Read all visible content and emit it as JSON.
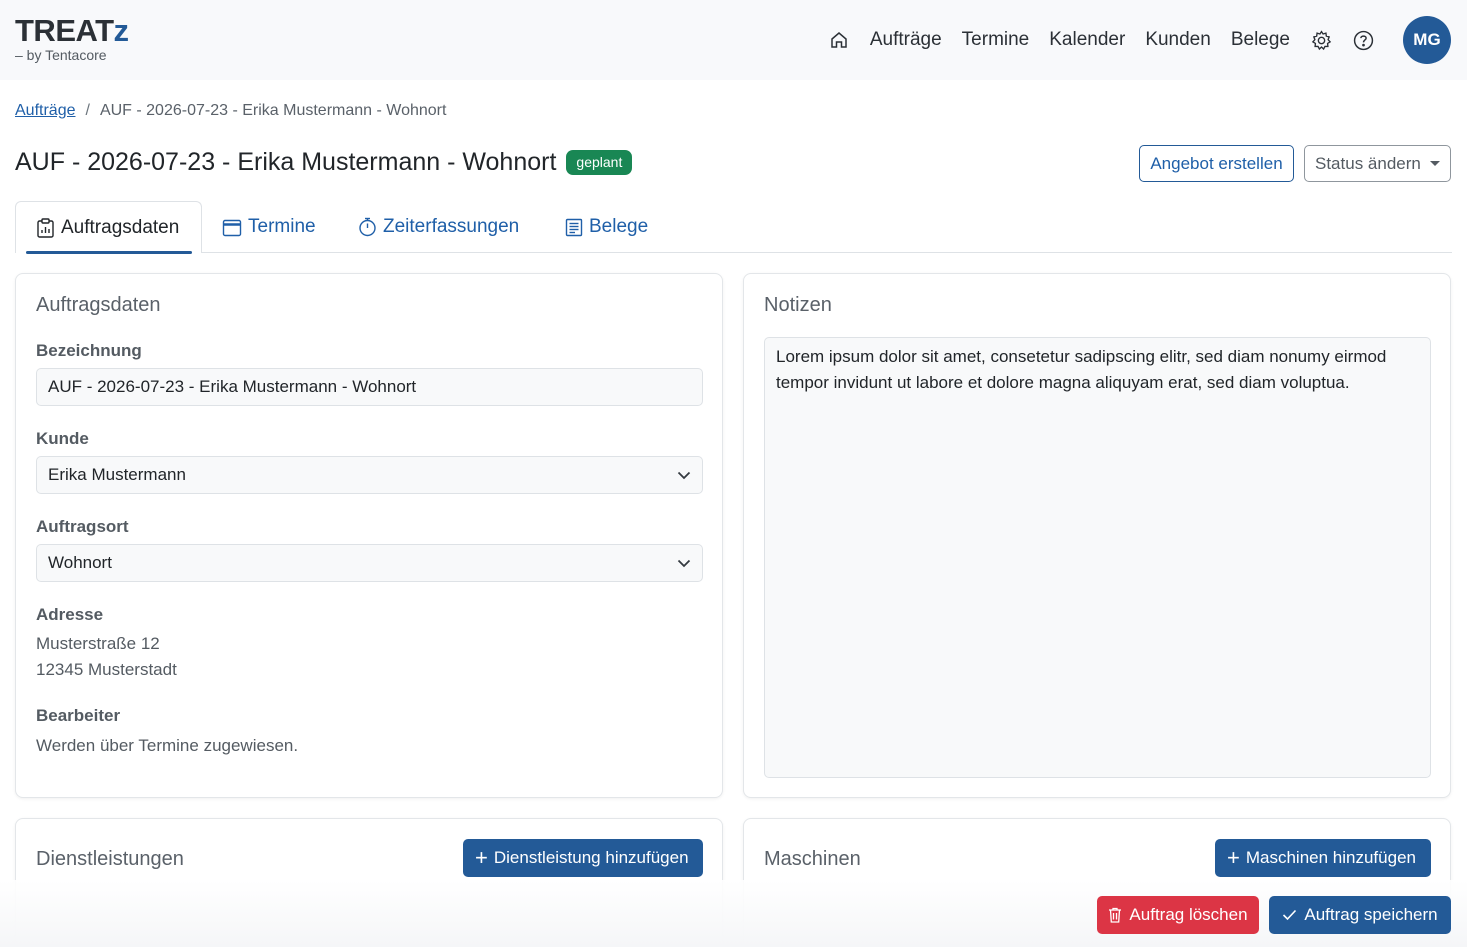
{
  "brand": {
    "name": "TREATz",
    "name_main": "TREAT",
    "name_accent": "z",
    "tagline": "– by Tentacore"
  },
  "nav": {
    "items": [
      {
        "label": "Aufträge"
      },
      {
        "label": "Termine"
      },
      {
        "label": "Kalender"
      },
      {
        "label": "Kunden"
      },
      {
        "label": "Belege"
      }
    ],
    "avatar_initials": "MG"
  },
  "breadcrumb": {
    "parent": "Aufträge",
    "separator": "/",
    "current": "AUF - 2026-07-23 - Erika Mustermann - Wohnort"
  },
  "header": {
    "title": "AUF - 2026-07-23 - Erika Mustermann - Wohnort",
    "status_badge": "geplant",
    "create_offer_label": "Angebot erstellen",
    "change_status_label": "Status ändern"
  },
  "tabs": [
    {
      "label": "Auftragsdaten",
      "icon": "clipboard-data-icon",
      "active": true
    },
    {
      "label": "Termine",
      "icon": "calendar-icon",
      "active": false
    },
    {
      "label": "Zeiterfassungen",
      "icon": "stopwatch-icon",
      "active": false
    },
    {
      "label": "Belege",
      "icon": "receipt-icon",
      "active": false
    }
  ],
  "order_card": {
    "title": "Auftragsdaten",
    "designation_label": "Bezeichnung",
    "designation_value": "AUF - 2026-07-23 - Erika Mustermann - Wohnort",
    "customer_label": "Kunde",
    "customer_value": "Erika Mustermann",
    "location_label": "Auftragsort",
    "location_value": "Wohnort",
    "address_label": "Adresse",
    "address_line1": "Musterstraße 12",
    "address_line2": "12345 Musterstadt",
    "staff_label": "Bearbeiter",
    "staff_value": "Werden über Termine zugewiesen."
  },
  "notes_card": {
    "title": "Notizen",
    "text": "Lorem ipsum dolor sit amet, consetetur sadipscing elitr, sed diam nonumy eirmod tempor invidunt ut labore et dolore magna aliquyam erat, sed diam voluptua."
  },
  "services_card": {
    "title": "Dienstleistungen",
    "add_label": "Dienstleistung hinzufügen"
  },
  "machines_card": {
    "title": "Maschinen",
    "add_label": "Maschinen hinzufügen"
  },
  "actions": {
    "delete_label": "Auftrag löschen",
    "save_label": "Auftrag speichern"
  },
  "colors": {
    "primary": "#235a97",
    "success": "#198754",
    "danger": "#dc3545"
  }
}
